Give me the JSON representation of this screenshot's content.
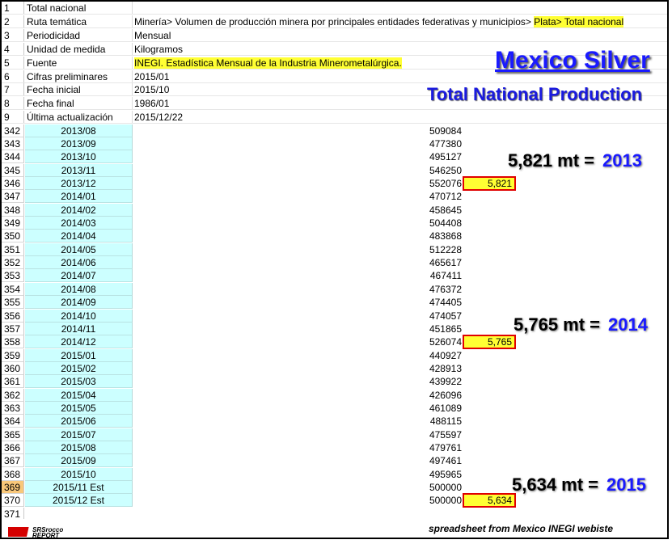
{
  "header_rows": [
    {
      "n": "1",
      "label": "Total nacional",
      "value": "",
      "hl": ""
    },
    {
      "n": "2",
      "label": "Ruta temática",
      "value": "Minería> Volumen de producción minera por principales entidades federativas y municipios> ",
      "hl": "Plata> Total nacional"
    },
    {
      "n": "3",
      "label": "Periodicidad",
      "value": "Mensual",
      "hl": ""
    },
    {
      "n": "4",
      "label": "Unidad de medida",
      "value": "Kilogramos",
      "hl": ""
    },
    {
      "n": "5",
      "label": "Fuente",
      "value": "",
      "hl": "INEGI. Estadística Mensual de la Industria Minerometalúrgica."
    },
    {
      "n": "6",
      "label": "Cifras preliminares",
      "value": "2015/01",
      "hl": ""
    },
    {
      "n": "7",
      "label": "Fecha inicial",
      "value": "2015/10",
      "hl": ""
    },
    {
      "n": "8",
      "label": "Fecha final",
      "value": "1986/01",
      "hl": ""
    },
    {
      "n": "9",
      "label": "Última actualización",
      "value": "2015/12/22",
      "hl": ""
    }
  ],
  "data_rows": [
    {
      "n": "342",
      "date": "2013/08",
      "kg": "509084"
    },
    {
      "n": "343",
      "date": "2013/09",
      "kg": "477380"
    },
    {
      "n": "344",
      "date": "2013/10",
      "kg": "495127"
    },
    {
      "n": "345",
      "date": "2013/11",
      "kg": "546250"
    },
    {
      "n": "346",
      "date": "2013/12",
      "kg": "552076"
    },
    {
      "n": "347",
      "date": "2014/01",
      "kg": "470712"
    },
    {
      "n": "348",
      "date": "2014/02",
      "kg": "458645"
    },
    {
      "n": "349",
      "date": "2014/03",
      "kg": "504408"
    },
    {
      "n": "350",
      "date": "2014/04",
      "kg": "483868"
    },
    {
      "n": "351",
      "date": "2014/05",
      "kg": "512228"
    },
    {
      "n": "352",
      "date": "2014/06",
      "kg": "465617"
    },
    {
      "n": "353",
      "date": "2014/07",
      "kg": "467411"
    },
    {
      "n": "354",
      "date": "2014/08",
      "kg": "476372"
    },
    {
      "n": "355",
      "date": "2014/09",
      "kg": "474405"
    },
    {
      "n": "356",
      "date": "2014/10",
      "kg": "474057"
    },
    {
      "n": "357",
      "date": "2014/11",
      "kg": "451865"
    },
    {
      "n": "358",
      "date": "2014/12",
      "kg": "526074"
    },
    {
      "n": "359",
      "date": "2015/01",
      "kg": "440927"
    },
    {
      "n": "360",
      "date": "2015/02",
      "kg": "428913"
    },
    {
      "n": "361",
      "date": "2015/03",
      "kg": "439922"
    },
    {
      "n": "362",
      "date": "2015/04",
      "kg": "426096"
    },
    {
      "n": "363",
      "date": "2015/05",
      "kg": "461089"
    },
    {
      "n": "364",
      "date": "2015/06",
      "kg": "488115"
    },
    {
      "n": "365",
      "date": "2015/07",
      "kg": "475597"
    },
    {
      "n": "366",
      "date": "2015/08",
      "kg": "479761"
    },
    {
      "n": "367",
      "date": "2015/09",
      "kg": "497461"
    },
    {
      "n": "368",
      "date": "2015/10",
      "kg": "495965"
    },
    {
      "n": "369",
      "date": "2015/11 Est",
      "kg": "500000",
      "rowhl": true
    },
    {
      "n": "370",
      "date": "2015/12 Est",
      "kg": "500000"
    },
    {
      "n": "371",
      "date": "",
      "kg": ""
    }
  ],
  "totals": [
    {
      "row": "346",
      "value": "5,821"
    },
    {
      "row": "358",
      "value": "5,765"
    },
    {
      "row": "370",
      "value": "5,634"
    }
  ],
  "title": "Mexico Silver",
  "subtitle": "Total National Production",
  "annotations": [
    {
      "text": "5,821 mt =",
      "year": "2013"
    },
    {
      "text": "5,765 mt =",
      "year": "2014"
    },
    {
      "text": "5,634 mt =",
      "year": "2015"
    }
  ],
  "logo_text": "SRSrocco REPORT",
  "credit": "spreadsheet from Mexico INEGI webiste",
  "colors": {
    "accent_blue": "#1a1aff",
    "highlight_yellow": "#ffff33",
    "date_cell": "#ccffff",
    "box_red": "#e00000"
  }
}
